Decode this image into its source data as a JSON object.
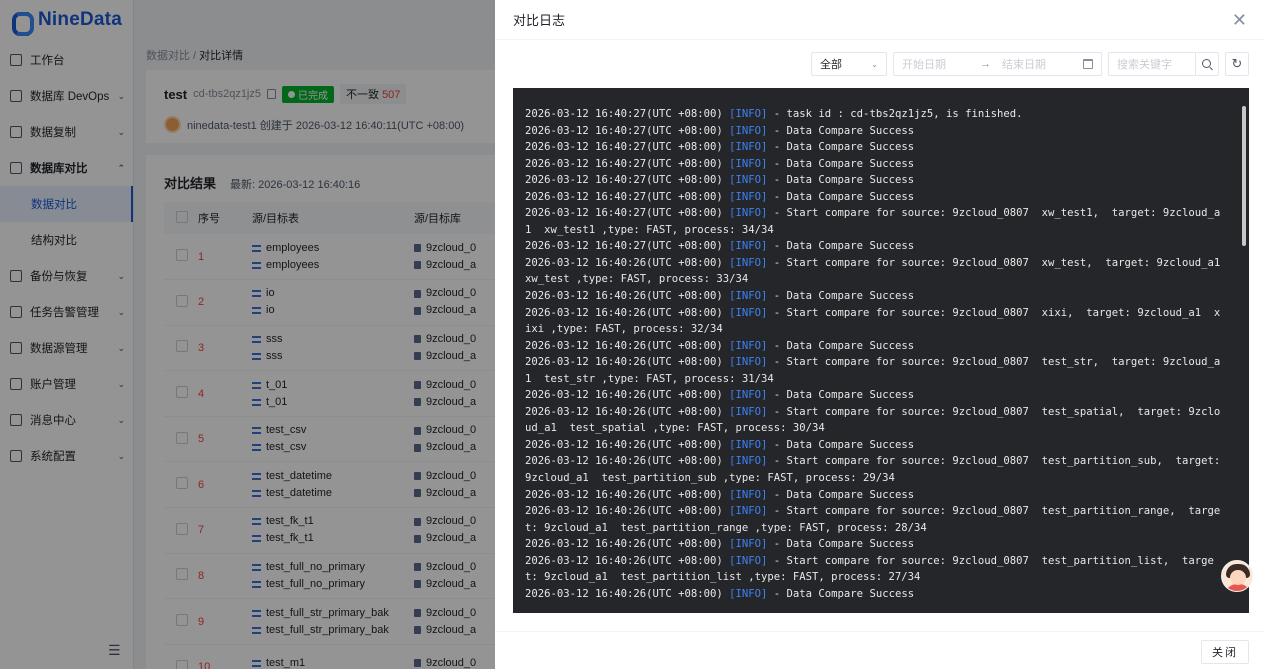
{
  "app": {
    "brand": "NineData",
    "nav": [
      {
        "label": "工作台",
        "chevron": ""
      },
      {
        "label": "数据库 DevOps",
        "chevron": "⌄"
      },
      {
        "label": "数据复制",
        "chevron": "⌄"
      },
      {
        "label": "数据库对比",
        "chevron": "⌃",
        "expanded": true
      },
      {
        "label": "备份与恢复",
        "chevron": "⌄"
      },
      {
        "label": "任务告警管理",
        "chevron": "⌄"
      },
      {
        "label": "数据源管理",
        "chevron": "⌄"
      },
      {
        "label": "账户管理",
        "chevron": "⌄"
      },
      {
        "label": "消息中心",
        "chevron": "⌄"
      },
      {
        "label": "系统配置",
        "chevron": "⌄"
      }
    ],
    "nav_sub": [
      "数据对比",
      "结构对比"
    ],
    "collapse_icon": "☰"
  },
  "breadcrumb": {
    "parent": "数据对比",
    "sep": " / ",
    "current": "对比详情"
  },
  "task": {
    "name": "test",
    "id": "cd-tbs2qz1jz5",
    "status": "已完成",
    "diff_label": "不一致",
    "diff_count": "507",
    "creator_line": "ninedata-test1 创建于 2026-03-12 16:40:11(UTC +08:00)"
  },
  "results": {
    "title": "对比结果",
    "latest": "最新: 2026-03-12 16:40:16",
    "columns": [
      "序号",
      "源/目标表",
      "源/目标库"
    ],
    "rows": [
      {
        "seq": "1",
        "src": "employees",
        "dst": "employees",
        "db1": "9zcloud_0",
        "db2": "9zcloud_a"
      },
      {
        "seq": "2",
        "src": "io",
        "dst": "io",
        "db1": "9zcloud_0",
        "db2": "9zcloud_a"
      },
      {
        "seq": "3",
        "src": "sss",
        "dst": "sss",
        "db1": "9zcloud_0",
        "db2": "9zcloud_a"
      },
      {
        "seq": "4",
        "src": "t_01",
        "dst": "t_01",
        "db1": "9zcloud_0",
        "db2": "9zcloud_a"
      },
      {
        "seq": "5",
        "src": "test_csv",
        "dst": "test_csv",
        "db1": "9zcloud_0",
        "db2": "9zcloud_a"
      },
      {
        "seq": "6",
        "src": "test_datetime",
        "dst": "test_datetime",
        "db1": "9zcloud_0",
        "db2": "9zcloud_a"
      },
      {
        "seq": "7",
        "src": "test_fk_t1",
        "dst": "test_fk_t1",
        "db1": "9zcloud_0",
        "db2": "9zcloud_a"
      },
      {
        "seq": "8",
        "src": "test_full_no_primary",
        "dst": "test_full_no_primary",
        "db1": "9zcloud_0",
        "db2": "9zcloud_a"
      },
      {
        "seq": "9",
        "src": "test_full_str_primary_bak",
        "dst": "test_full_str_primary_bak",
        "db1": "9zcloud_0",
        "db2": "9zcloud_a"
      },
      {
        "seq": "10",
        "src": "test_m1",
        "dst": "",
        "db1": "9zcloud_0",
        "db2": ""
      }
    ]
  },
  "drawer": {
    "title": "对比日志",
    "close_icon": "✕",
    "level_select": "全部",
    "start_placeholder": "开始日期",
    "arrow": "→",
    "end_placeholder": "结束日期",
    "search_placeholder": "搜索关键字",
    "refresh_icon": "↻",
    "footer_close": "关闭",
    "log_lines": [
      {
        "ts": "2026-03-12 16:40:27(UTC +08:00)",
        "level": "[INFO]",
        "msg": " - task id : cd-tbs2qz1jz5, is finished."
      },
      {
        "ts": "2026-03-12 16:40:27(UTC +08:00)",
        "level": "[INFO]",
        "msg": " - Data Compare Success"
      },
      {
        "ts": "2026-03-12 16:40:27(UTC +08:00)",
        "level": "[INFO]",
        "msg": " - Data Compare Success"
      },
      {
        "ts": "2026-03-12 16:40:27(UTC +08:00)",
        "level": "[INFO]",
        "msg": " - Data Compare Success"
      },
      {
        "ts": "2026-03-12 16:40:27(UTC +08:00)",
        "level": "[INFO]",
        "msg": " - Data Compare Success"
      },
      {
        "ts": "2026-03-12 16:40:27(UTC +08:00)",
        "level": "[INFO]",
        "msg": " - Data Compare Success"
      },
      {
        "ts": "2026-03-12 16:40:27(UTC +08:00)",
        "level": "[INFO]",
        "msg": " - Start compare for source: 9zcloud_0807  xw_test1,  target: 9zcloud_a1  xw_test1 ,type: FAST, process: 34/34"
      },
      {
        "ts": "2026-03-12 16:40:27(UTC +08:00)",
        "level": "[INFO]",
        "msg": " - Data Compare Success"
      },
      {
        "ts": "2026-03-12 16:40:26(UTC +08:00)",
        "level": "[INFO]",
        "msg": " - Start compare for source: 9zcloud_0807  xw_test,  target: 9zcloud_a1  xw_test ,type: FAST, process: 33/34"
      },
      {
        "ts": "2026-03-12 16:40:26(UTC +08:00)",
        "level": "[INFO]",
        "msg": " - Data Compare Success"
      },
      {
        "ts": "2026-03-12 16:40:26(UTC +08:00)",
        "level": "[INFO]",
        "msg": " - Start compare for source: 9zcloud_0807  xixi,  target: 9zcloud_a1  xixi ,type: FAST, process: 32/34"
      },
      {
        "ts": "2026-03-12 16:40:26(UTC +08:00)",
        "level": "[INFO]",
        "msg": " - Data Compare Success"
      },
      {
        "ts": "2026-03-12 16:40:26(UTC +08:00)",
        "level": "[INFO]",
        "msg": " - Start compare for source: 9zcloud_0807  test_str,  target: 9zcloud_a1  test_str ,type: FAST, process: 31/34"
      },
      {
        "ts": "2026-03-12 16:40:26(UTC +08:00)",
        "level": "[INFO]",
        "msg": " - Data Compare Success"
      },
      {
        "ts": "2026-03-12 16:40:26(UTC +08:00)",
        "level": "[INFO]",
        "msg": " - Start compare for source: 9zcloud_0807  test_spatial,  target: 9zcloud_a1  test_spatial ,type: FAST, process: 30/34"
      },
      {
        "ts": "2026-03-12 16:40:26(UTC +08:00)",
        "level": "[INFO]",
        "msg": " - Data Compare Success"
      },
      {
        "ts": "2026-03-12 16:40:26(UTC +08:00)",
        "level": "[INFO]",
        "msg": " - Start compare for source: 9zcloud_0807  test_partition_sub,  target: 9zcloud_a1  test_partition_sub ,type: FAST, process: 29/34"
      },
      {
        "ts": "2026-03-12 16:40:26(UTC +08:00)",
        "level": "[INFO]",
        "msg": " - Data Compare Success"
      },
      {
        "ts": "2026-03-12 16:40:26(UTC +08:00)",
        "level": "[INFO]",
        "msg": " - Start compare for source: 9zcloud_0807  test_partition_range,  target: 9zcloud_a1  test_partition_range ,type: FAST, process: 28/34"
      },
      {
        "ts": "2026-03-12 16:40:26(UTC +08:00)",
        "level": "[INFO]",
        "msg": " - Data Compare Success"
      },
      {
        "ts": "2026-03-12 16:40:26(UTC +08:00)",
        "level": "[INFO]",
        "msg": " - Start compare for source: 9zcloud_0807  test_partition_list,  target: 9zcloud_a1  test_partition_list ,type: FAST, process: 27/34"
      },
      {
        "ts": "2026-03-12 16:40:26(UTC +08:00)",
        "level": "[INFO]",
        "msg": " - Data Compare Success"
      }
    ]
  },
  "colors": {
    "accent": "#1a5bd6",
    "info_level": "#3f82f0",
    "log_bg": "#24262a",
    "danger": "#f53f3f",
    "success": "#00b42a"
  },
  "icons": {
    "drawer_close": "close-icon",
    "calendar": "calendar-icon",
    "search": "search-icon",
    "refresh": "refresh-icon",
    "assistant": "assistant-avatar-icon"
  }
}
